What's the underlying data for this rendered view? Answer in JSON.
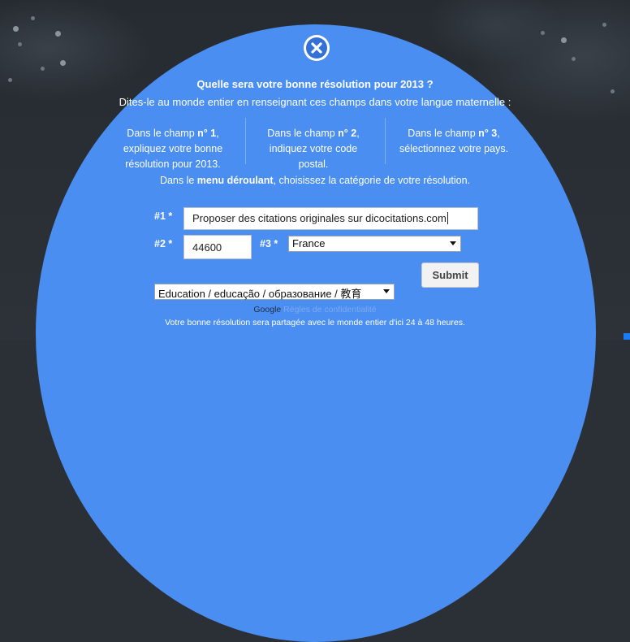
{
  "dialog": {
    "title": "Quelle sera votre bonne résolution pour 2013 ?",
    "subtitle": "Dites-le au monde entier en renseignant ces champs dans votre langue maternelle :",
    "columns": [
      {
        "pre": "Dans le champ ",
        "num": "n° 1",
        "post": ",",
        "rest": [
          "expliquez votre bonne",
          "résolution pour 2013."
        ]
      },
      {
        "pre": "Dans le champ ",
        "num": "n° 2",
        "post": ",",
        "rest": [
          "indiquez votre code",
          "postal."
        ]
      },
      {
        "pre": "Dans le champ ",
        "num": "n° 3",
        "post": ",",
        "rest": [
          "sélectionnez votre pays."
        ]
      }
    ],
    "menu_line": {
      "pre": "Dans le ",
      "bold": "menu déroulant",
      "post": ", choisissez la catégorie de votre résolution."
    }
  },
  "form": {
    "label1": "#1 *",
    "label2": "#2 *",
    "label3": "#3 *",
    "resolution_value": "Proposer des citations originales sur dicocitations.com",
    "postal_value": "44600",
    "country_selected": "France",
    "category_selected": "Education / educação / образование / 教育",
    "submit_label": "Submit"
  },
  "footer": {
    "google": "Google",
    "privacy_link": "Règles de confidentialité",
    "note": "Votre bonne résolution sera partagée avec le monde entier d'ici 24 à 48 heures."
  },
  "icons": {
    "close": "close-icon",
    "dropdown": "chevron-down-icon"
  },
  "colors": {
    "dome": "#4a8ef2",
    "close_inner": "#3470d6",
    "link": "#7ea9ec"
  }
}
